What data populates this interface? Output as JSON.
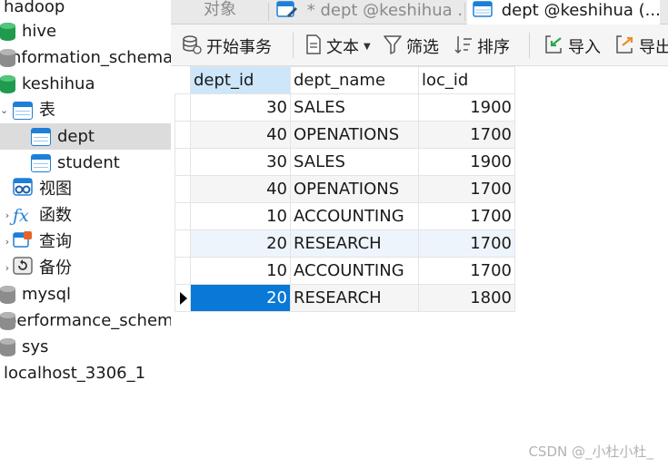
{
  "navigator": {
    "items": [
      {
        "label": "hadoop",
        "icon": "none"
      },
      {
        "label": "hive",
        "icon": "database-green-icon"
      },
      {
        "label": "information_schema",
        "icon": "database-gray-icon"
      },
      {
        "label": "keshihua",
        "icon": "database-green-icon"
      },
      {
        "label": "表",
        "icon": "tables-folder-icon"
      },
      {
        "label": "dept",
        "icon": "table-icon"
      },
      {
        "label": "student",
        "icon": "table-icon"
      },
      {
        "label": "视图",
        "icon": "views-icon"
      },
      {
        "label": "函数",
        "icon": "function-icon"
      },
      {
        "label": "查询",
        "icon": "query-icon"
      },
      {
        "label": "备份",
        "icon": "backup-icon"
      },
      {
        "label": "mysql",
        "icon": "database-gray-icon"
      },
      {
        "label": "performance_schema",
        "icon": "database-gray-icon"
      },
      {
        "label": "sys",
        "icon": "database-gray-icon"
      },
      {
        "label": "localhost_3306_1",
        "icon": "none"
      }
    ],
    "selected": "dept"
  },
  "tabs": [
    {
      "label": "对象",
      "active": false
    },
    {
      "label": "* dept @keshihua ...",
      "active": false
    },
    {
      "label": "dept @keshihua (...",
      "active": true
    }
  ],
  "toolbar": {
    "begin_transaction": "开始事务",
    "text": "文本",
    "filter": "筛选",
    "sort": "排序",
    "import": "导入",
    "export": "导出"
  },
  "table": {
    "columns": [
      "dept_id",
      "dept_name",
      "loc_id"
    ],
    "rows": [
      [
        "30",
        "SALES",
        "1900"
      ],
      [
        "40",
        "OPENATIONS",
        "1700"
      ],
      [
        "30",
        "SALES",
        "1900"
      ],
      [
        "40",
        "OPENATIONS",
        "1700"
      ],
      [
        "10",
        "ACCOUNTING",
        "1700"
      ],
      [
        "20",
        "RESEARCH",
        "1700"
      ],
      [
        "10",
        "ACCOUNTING",
        "1700"
      ],
      [
        "20",
        "RESEARCH",
        "1800"
      ]
    ]
  },
  "colors": {
    "accent": "#0a78d7",
    "selected_header": "#cde6fa",
    "db_green": "#1f9b4d",
    "db_gray": "#8c8c8c"
  },
  "watermark": "CSDN @_小杜小杜_"
}
